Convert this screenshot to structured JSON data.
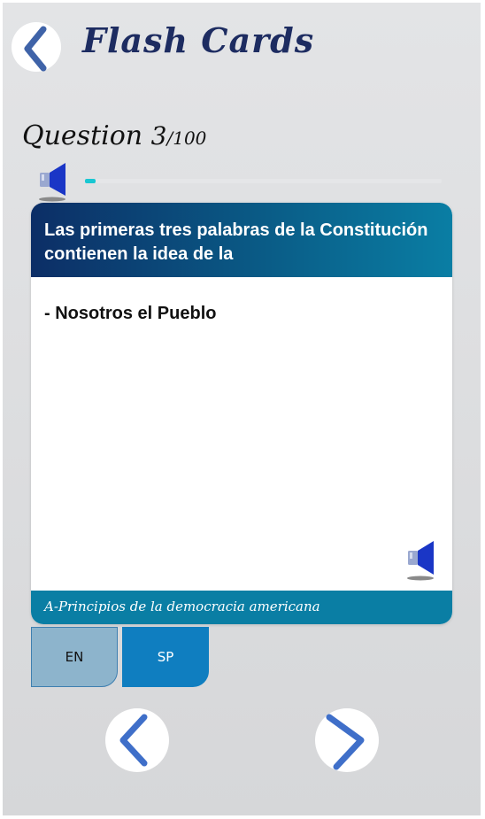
{
  "header": {
    "title": "Flash Cards"
  },
  "question": {
    "label": "Question",
    "current": "3",
    "total": "/100",
    "progress_fraction": 0.03
  },
  "card": {
    "question_text": "Las primeras tres palabras de la Constitución contienen la idea de la",
    "answer_text": "- Nosotros el Pueblo",
    "category": "A-Principios de la democracia americana"
  },
  "language": {
    "en_label": "EN",
    "sp_label": "SP",
    "selected": "SP"
  },
  "icons": {
    "back": "chevron-left-icon",
    "audio": "speaker-icon",
    "prev": "chevron-left-icon",
    "next": "chevron-right-icon"
  },
  "colors": {
    "title": "#1d2c61",
    "accent": "#0a7ea4",
    "progress": "#19c7d2",
    "chevron": "#3f6fc9",
    "speaker": "#1a36c6"
  }
}
